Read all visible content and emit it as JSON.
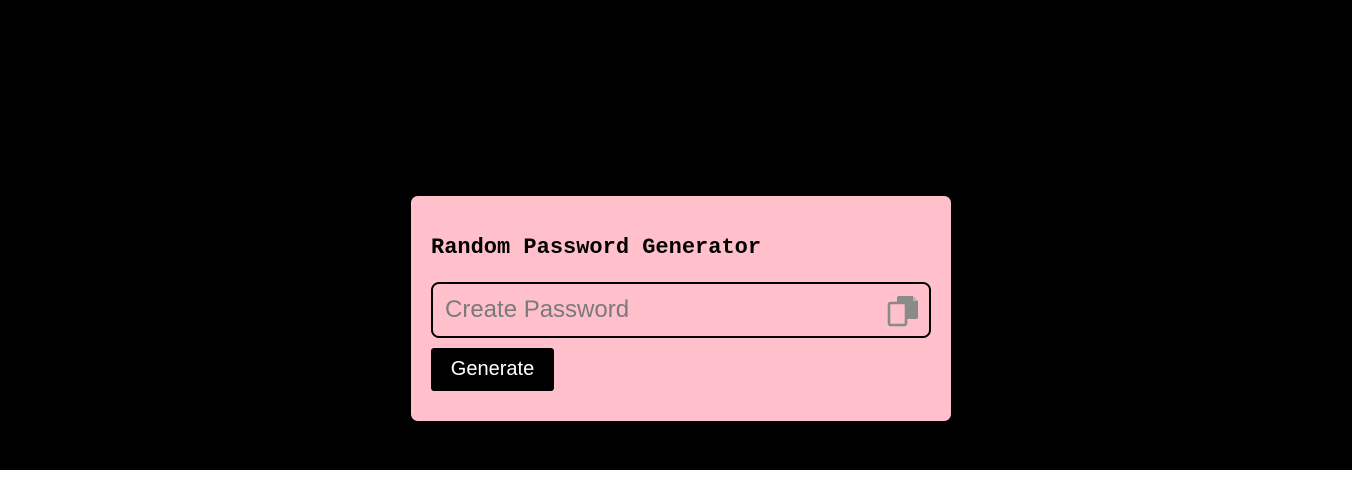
{
  "app": {
    "title": "Random Password Generator"
  },
  "password_field": {
    "value": "",
    "placeholder": "Create Password"
  },
  "copy_button": {
    "icon": "copy-icon"
  },
  "generate_button": {
    "label": "Generate"
  },
  "colors": {
    "page_background": "#000000",
    "card_background": "#ffc0cb",
    "button_background": "#000000",
    "button_text": "#ffffff",
    "icon_color": "#8a8a8a"
  }
}
